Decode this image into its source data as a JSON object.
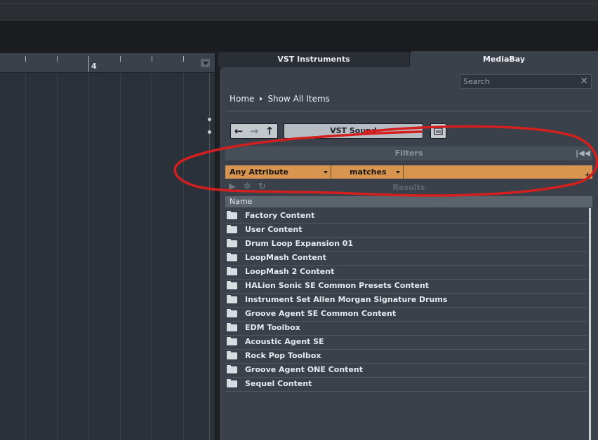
{
  "ruler": {
    "bar_number": "4"
  },
  "tabs": {
    "vst_instruments": "VST Instruments",
    "mediabay": "MediaBay"
  },
  "search": {
    "placeholder": "Search",
    "clear_icon": "close-icon"
  },
  "breadcrumb": {
    "home": "Home",
    "current": "Show All Items"
  },
  "navigation": {
    "back_icon": "arrow-left-icon",
    "forward_icon": "arrow-right-icon",
    "up_icon": "arrow-up-icon",
    "location_label": "VST Sound",
    "folder_icon": "folder-browse-icon"
  },
  "filters": {
    "title": "Filters",
    "collapse_icon": "collapse-left-icon",
    "attribute_value": "Any Attribute",
    "operator_value": "matches",
    "add_icon": "plus-icon"
  },
  "results": {
    "title": "Results",
    "column_name": "Name",
    "items": [
      "Factory Content",
      "User Content",
      "Drum Loop Expansion 01",
      "LoopMash Content",
      "LoopMash 2 Content",
      "HALion Sonic SE Common Presets Content",
      "Instrument Set Allen Morgan Signature Drums",
      "Groove Agent SE Common Content",
      "EDM Toolbox",
      "Acoustic Agent SE",
      "Rock Pop Toolbox",
      "Groove Agent ONE Content",
      "Sequel Content"
    ]
  },
  "colors": {
    "filter_row": "#d8954f",
    "panel": "#3a414a",
    "annotation": "#d41f1f"
  }
}
